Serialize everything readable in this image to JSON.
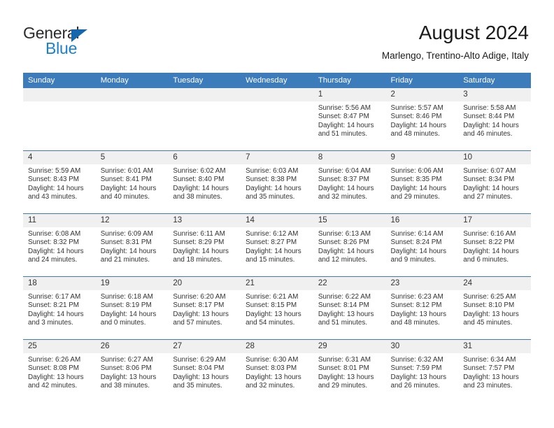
{
  "brand": {
    "name_part1": "General",
    "name_part2": "Blue",
    "accent_color": "#1b80d0",
    "triangle_color": "#1467ac"
  },
  "header": {
    "title": "August 2024",
    "subtitle": "Marlengo, Trentino-Alto Adige, Italy"
  },
  "calendar": {
    "header_bg": "#3d7cba",
    "daynum_bg": "#f0f0f0",
    "weekday_headers": [
      "Sunday",
      "Monday",
      "Tuesday",
      "Wednesday",
      "Thursday",
      "Friday",
      "Saturday"
    ],
    "weeks": [
      [
        {
          "day": "",
          "empty": true
        },
        {
          "day": "",
          "empty": true
        },
        {
          "day": "",
          "empty": true
        },
        {
          "day": "",
          "empty": true
        },
        {
          "day": "1",
          "sunrise": "Sunrise: 5:56 AM",
          "sunset": "Sunset: 8:47 PM",
          "daylight_1": "Daylight: 14 hours",
          "daylight_2": "and 51 minutes."
        },
        {
          "day": "2",
          "sunrise": "Sunrise: 5:57 AM",
          "sunset": "Sunset: 8:46 PM",
          "daylight_1": "Daylight: 14 hours",
          "daylight_2": "and 48 minutes."
        },
        {
          "day": "3",
          "sunrise": "Sunrise: 5:58 AM",
          "sunset": "Sunset: 8:44 PM",
          "daylight_1": "Daylight: 14 hours",
          "daylight_2": "and 46 minutes."
        }
      ],
      [
        {
          "day": "4",
          "sunrise": "Sunrise: 5:59 AM",
          "sunset": "Sunset: 8:43 PM",
          "daylight_1": "Daylight: 14 hours",
          "daylight_2": "and 43 minutes."
        },
        {
          "day": "5",
          "sunrise": "Sunrise: 6:01 AM",
          "sunset": "Sunset: 8:41 PM",
          "daylight_1": "Daylight: 14 hours",
          "daylight_2": "and 40 minutes."
        },
        {
          "day": "6",
          "sunrise": "Sunrise: 6:02 AM",
          "sunset": "Sunset: 8:40 PM",
          "daylight_1": "Daylight: 14 hours",
          "daylight_2": "and 38 minutes."
        },
        {
          "day": "7",
          "sunrise": "Sunrise: 6:03 AM",
          "sunset": "Sunset: 8:38 PM",
          "daylight_1": "Daylight: 14 hours",
          "daylight_2": "and 35 minutes."
        },
        {
          "day": "8",
          "sunrise": "Sunrise: 6:04 AM",
          "sunset": "Sunset: 8:37 PM",
          "daylight_1": "Daylight: 14 hours",
          "daylight_2": "and 32 minutes."
        },
        {
          "day": "9",
          "sunrise": "Sunrise: 6:06 AM",
          "sunset": "Sunset: 8:35 PM",
          "daylight_1": "Daylight: 14 hours",
          "daylight_2": "and 29 minutes."
        },
        {
          "day": "10",
          "sunrise": "Sunrise: 6:07 AM",
          "sunset": "Sunset: 8:34 PM",
          "daylight_1": "Daylight: 14 hours",
          "daylight_2": "and 27 minutes."
        }
      ],
      [
        {
          "day": "11",
          "sunrise": "Sunrise: 6:08 AM",
          "sunset": "Sunset: 8:32 PM",
          "daylight_1": "Daylight: 14 hours",
          "daylight_2": "and 24 minutes."
        },
        {
          "day": "12",
          "sunrise": "Sunrise: 6:09 AM",
          "sunset": "Sunset: 8:31 PM",
          "daylight_1": "Daylight: 14 hours",
          "daylight_2": "and 21 minutes."
        },
        {
          "day": "13",
          "sunrise": "Sunrise: 6:11 AM",
          "sunset": "Sunset: 8:29 PM",
          "daylight_1": "Daylight: 14 hours",
          "daylight_2": "and 18 minutes."
        },
        {
          "day": "14",
          "sunrise": "Sunrise: 6:12 AM",
          "sunset": "Sunset: 8:27 PM",
          "daylight_1": "Daylight: 14 hours",
          "daylight_2": "and 15 minutes."
        },
        {
          "day": "15",
          "sunrise": "Sunrise: 6:13 AM",
          "sunset": "Sunset: 8:26 PM",
          "daylight_1": "Daylight: 14 hours",
          "daylight_2": "and 12 minutes."
        },
        {
          "day": "16",
          "sunrise": "Sunrise: 6:14 AM",
          "sunset": "Sunset: 8:24 PM",
          "daylight_1": "Daylight: 14 hours",
          "daylight_2": "and 9 minutes."
        },
        {
          "day": "17",
          "sunrise": "Sunrise: 6:16 AM",
          "sunset": "Sunset: 8:22 PM",
          "daylight_1": "Daylight: 14 hours",
          "daylight_2": "and 6 minutes."
        }
      ],
      [
        {
          "day": "18",
          "sunrise": "Sunrise: 6:17 AM",
          "sunset": "Sunset: 8:21 PM",
          "daylight_1": "Daylight: 14 hours",
          "daylight_2": "and 3 minutes."
        },
        {
          "day": "19",
          "sunrise": "Sunrise: 6:18 AM",
          "sunset": "Sunset: 8:19 PM",
          "daylight_1": "Daylight: 14 hours",
          "daylight_2": "and 0 minutes."
        },
        {
          "day": "20",
          "sunrise": "Sunrise: 6:20 AM",
          "sunset": "Sunset: 8:17 PM",
          "daylight_1": "Daylight: 13 hours",
          "daylight_2": "and 57 minutes."
        },
        {
          "day": "21",
          "sunrise": "Sunrise: 6:21 AM",
          "sunset": "Sunset: 8:15 PM",
          "daylight_1": "Daylight: 13 hours",
          "daylight_2": "and 54 minutes."
        },
        {
          "day": "22",
          "sunrise": "Sunrise: 6:22 AM",
          "sunset": "Sunset: 8:14 PM",
          "daylight_1": "Daylight: 13 hours",
          "daylight_2": "and 51 minutes."
        },
        {
          "day": "23",
          "sunrise": "Sunrise: 6:23 AM",
          "sunset": "Sunset: 8:12 PM",
          "daylight_1": "Daylight: 13 hours",
          "daylight_2": "and 48 minutes."
        },
        {
          "day": "24",
          "sunrise": "Sunrise: 6:25 AM",
          "sunset": "Sunset: 8:10 PM",
          "daylight_1": "Daylight: 13 hours",
          "daylight_2": "and 45 minutes."
        }
      ],
      [
        {
          "day": "25",
          "sunrise": "Sunrise: 6:26 AM",
          "sunset": "Sunset: 8:08 PM",
          "daylight_1": "Daylight: 13 hours",
          "daylight_2": "and 42 minutes."
        },
        {
          "day": "26",
          "sunrise": "Sunrise: 6:27 AM",
          "sunset": "Sunset: 8:06 PM",
          "daylight_1": "Daylight: 13 hours",
          "daylight_2": "and 38 minutes."
        },
        {
          "day": "27",
          "sunrise": "Sunrise: 6:29 AM",
          "sunset": "Sunset: 8:04 PM",
          "daylight_1": "Daylight: 13 hours",
          "daylight_2": "and 35 minutes."
        },
        {
          "day": "28",
          "sunrise": "Sunrise: 6:30 AM",
          "sunset": "Sunset: 8:03 PM",
          "daylight_1": "Daylight: 13 hours",
          "daylight_2": "and 32 minutes."
        },
        {
          "day": "29",
          "sunrise": "Sunrise: 6:31 AM",
          "sunset": "Sunset: 8:01 PM",
          "daylight_1": "Daylight: 13 hours",
          "daylight_2": "and 29 minutes."
        },
        {
          "day": "30",
          "sunrise": "Sunrise: 6:32 AM",
          "sunset": "Sunset: 7:59 PM",
          "daylight_1": "Daylight: 13 hours",
          "daylight_2": "and 26 minutes."
        },
        {
          "day": "31",
          "sunrise": "Sunrise: 6:34 AM",
          "sunset": "Sunset: 7:57 PM",
          "daylight_1": "Daylight: 13 hours",
          "daylight_2": "and 23 minutes."
        }
      ]
    ]
  }
}
